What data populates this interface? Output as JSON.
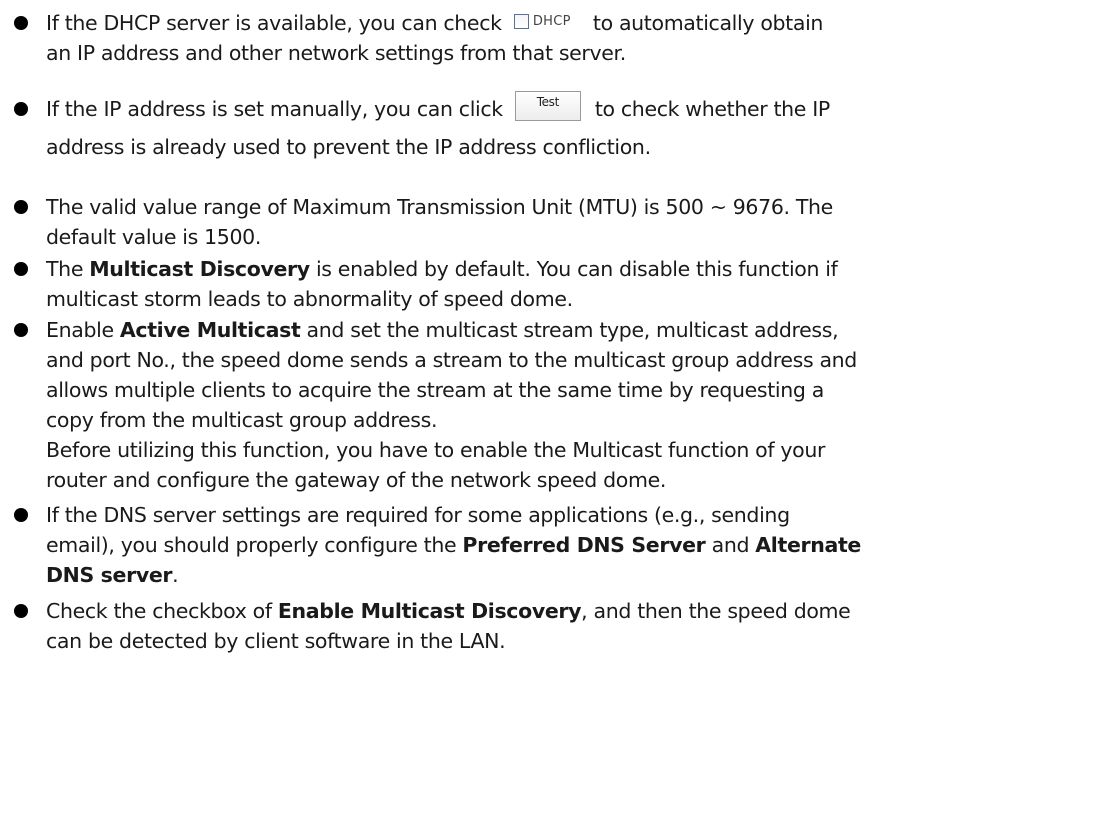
{
  "dhcp": {
    "line1_before": "If the DHCP server is available, you can check",
    "checkbox_label": "DHCP",
    "line1_after": "to automatically obtain",
    "line2": "an IP address and other network settings from that server."
  },
  "manual_ip": {
    "line1_before": "If the IP address is set manually, you can click",
    "button_label": "Test",
    "line1_after": "to check whether the IP",
    "line2": "address is already used to prevent the IP address confliction."
  },
  "mtu": {
    "line1": "The valid value range of Maximum Transmission Unit (MTU) is 500 ~ 9676. The",
    "line2": "default value is 1500."
  },
  "multicast_discovery": {
    "line1_pre": "The ",
    "line1_bold": "Multicast Discovery",
    "line1_post": " is enabled by default. You can disable this function if",
    "line2": "multicast storm leads to abnormality of speed dome."
  },
  "active_multicast": {
    "line1_pre": "Enable ",
    "line1_bold": "Active Multicast",
    "line1_post": " and set the multicast stream type, multicast address,",
    "line2": "and port No., the speed dome sends a stream to the multicast group address and",
    "line3": "allows multiple clients to acquire the stream at the same time by requesting a",
    "line4": "copy from the multicast group address.",
    "line5": "Before utilizing this function, you have to enable the Multicast function of your",
    "line6": "router and configure the gateway of the network speed dome."
  },
  "dns": {
    "line1": "If the DNS server settings are required for some applications (e.g., sending",
    "line2_pre": "email), you should properly configure the ",
    "line2_bold1": "Preferred DNS Server",
    "line2_mid": " and ",
    "line2_bold2": "Alternate",
    "line3_bold": "DNS server",
    "line3_post": "."
  },
  "enable_discovery": {
    "line1_pre": "Check the checkbox of ",
    "line1_bold": "Enable Multicast Discovery",
    "line1_post": ", and then the speed dome",
    "line2": "can be detected by client software in the LAN."
  }
}
